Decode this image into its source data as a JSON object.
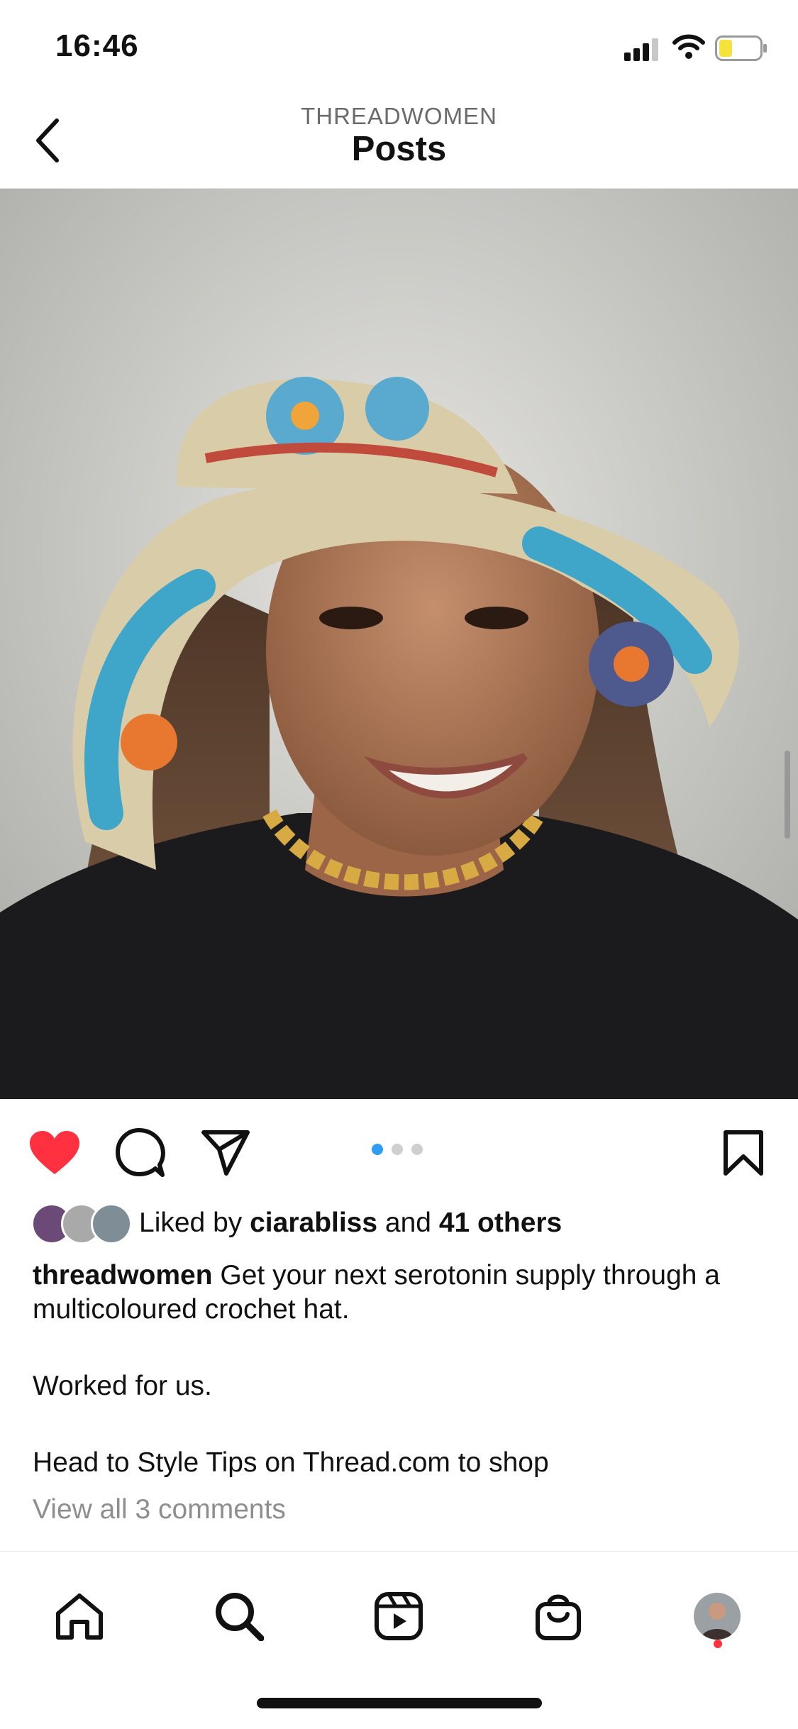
{
  "status_bar": {
    "time": "16:46"
  },
  "header": {
    "account": "THREADWOMEN",
    "title": "Posts"
  },
  "post": {
    "carousel": {
      "count": 3,
      "active_index": 0
    },
    "liked": true,
    "likes": {
      "prefix": "Liked by",
      "user": "ciarabliss",
      "middle": "and",
      "others": "41 others"
    },
    "caption": {
      "username": "threadwomen",
      "line1": "Get your next serotonin supply through a multicoloured crochet hat.",
      "line2": "Worked for us.",
      "line3": "Head to Style Tips on Thread.com to shop"
    },
    "view_comments": "View all 3 comments"
  },
  "colors": {
    "like": "#ff3040",
    "dot_active": "#2f9df4",
    "battery": "#f5e33b"
  },
  "tabs": [
    "home-icon",
    "search-icon",
    "reels-icon",
    "shop-icon",
    "profile-avatar"
  ]
}
